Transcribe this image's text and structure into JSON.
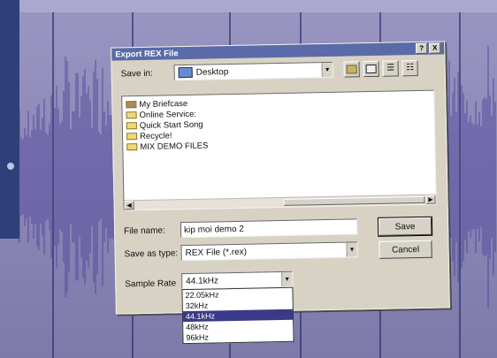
{
  "dialog": {
    "title": "Export REX File",
    "help_btn": "?",
    "close_btn": "X"
  },
  "save_in": {
    "label": "Save in:",
    "value": "Desktop"
  },
  "files": [
    {
      "name": "My Briefcase",
      "icon": "briefcase-icon"
    },
    {
      "name": "Online Service:",
      "icon": "folder-icon"
    },
    {
      "name": "Quick Start Song",
      "icon": "folder-icon"
    },
    {
      "name": "Recycle!",
      "icon": "folder-icon"
    },
    {
      "name": "MIX DEMO FILES",
      "icon": "folder-icon"
    }
  ],
  "file_name": {
    "label": "File name:",
    "value": "kip moi demo 2"
  },
  "save_as_type": {
    "label": "Save as type:",
    "value": "REX File (*.rex)"
  },
  "sample_rate": {
    "label": "Sample Rate",
    "value": "44.1kHz",
    "options": [
      "22.05kHz",
      "32kHz",
      "44.1kHz",
      "48kHz",
      "96kHz"
    ],
    "selected_index": 2
  },
  "buttons": {
    "save": "Save",
    "cancel": "Cancel"
  },
  "colors": {
    "titlebar": "#5b6aa8",
    "dialog_bg": "#d8d2c4",
    "waveform": "#4b3f9a",
    "background": "#8a86b4"
  }
}
